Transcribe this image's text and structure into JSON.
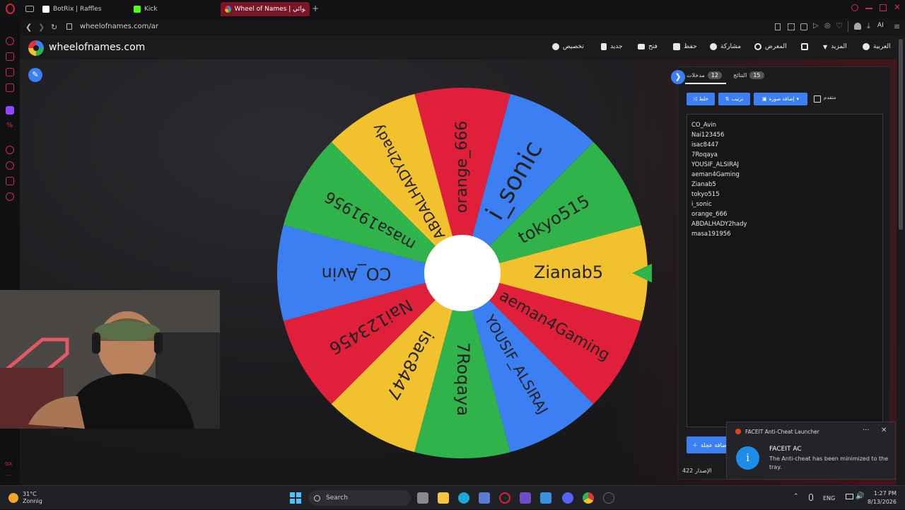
{
  "browser": {
    "tabs": [
      {
        "label": "BotRix | Raffles",
        "active": false,
        "favicon_color": "#ffffff"
      },
      {
        "label": "Kick",
        "active": false,
        "favicon_color": "#53fc18"
      },
      {
        "label": "Wheel of Names | العشوائي",
        "active": true,
        "favicon_color": "#e53238"
      }
    ],
    "new_tab_symbol": "+",
    "url": "wheelofnames.com/ar",
    "ai_label": "AI"
  },
  "site": {
    "name": "wheelofnames.com",
    "nav": [
      {
        "label": "تخصيص",
        "icon": "palette-icon"
      },
      {
        "label": "جديد",
        "icon": "file-icon"
      },
      {
        "label": "فتح",
        "icon": "folder-icon"
      },
      {
        "label": "حفظ",
        "icon": "save-icon"
      },
      {
        "label": "مشاركة",
        "icon": "share-icon"
      },
      {
        "label": "المعرض",
        "icon": "search-icon"
      },
      {
        "label": "",
        "icon": "fullscreen-icon"
      },
      {
        "label": "المزيد",
        "icon": "caret-down-icon"
      },
      {
        "label": "العربية",
        "icon": "globe-icon"
      }
    ]
  },
  "wheel": {
    "pointer_color": "#2fb34a",
    "center_color": "#ffffff",
    "segments": [
      {
        "name": "tokyo515",
        "color": "#2fb34a"
      },
      {
        "name": "i_sonic",
        "color": "#3b7ff3"
      },
      {
        "name": "orange_666",
        "color": "#e0203a"
      },
      {
        "name": "ABDALHADY2hady",
        "color": "#f2c12e"
      },
      {
        "name": "masa191956",
        "color": "#2fb34a"
      },
      {
        "name": "CO_Avin",
        "color": "#3b7ff3"
      },
      {
        "name": "Nai123456",
        "color": "#e0203a"
      },
      {
        "name": "isac8447",
        "color": "#f2c12e"
      },
      {
        "name": "7Roqaya",
        "color": "#2fb34a"
      },
      {
        "name": "YOUSIF_ALSIRAJ",
        "color": "#3b7ff3"
      },
      {
        "name": "aeman4Gaming",
        "color": "#e0203a"
      },
      {
        "name": "Zianab5",
        "color": "#f2c12e"
      }
    ]
  },
  "panel": {
    "tab_entries": {
      "label": "مدخلات",
      "count": "12"
    },
    "tab_results": {
      "label": "النتائج",
      "count": "15"
    },
    "shuffle_label": "خلط",
    "sort_label": "ترتيب",
    "add_image_label": "إضافة صورة",
    "advanced_label": "متقدم",
    "entries": [
      "CO_Avin",
      "Nai123456",
      "isac8447",
      "7Roqaya",
      "YOUSIF_ALSIRAJ",
      "aeman4Gaming",
      "Zianab5",
      "tokyo515",
      "i_sonic",
      "orange_666",
      "ABDALHADY2hady",
      "masa191956"
    ],
    "add_wheel_label": "إضافة عجلة",
    "version_label": "الإصدار",
    "version_number": "422"
  },
  "notification": {
    "app": "FACEIT Anti-Cheat Launcher",
    "title": "FACEIT AC",
    "body": "The Anti-cheat has been minimized to the tray.",
    "more_symbol": "···",
    "close_symbol": "✕",
    "info_symbol": "i"
  },
  "taskbar": {
    "temperature": "31°C",
    "weather": "Zonnig",
    "search_placeholder": "Search",
    "language": "ENG",
    "time": "1:27 PM",
    "date": "8/13/2026"
  },
  "sidebar_labels": {
    "gx": "GX",
    "more": "···"
  }
}
